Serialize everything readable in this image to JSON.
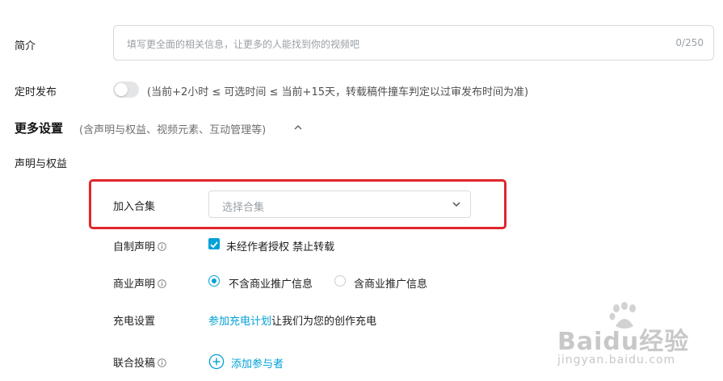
{
  "description": {
    "label": "简介",
    "placeholder": "填写更全面的相关信息，让更多的人能找到你的视频吧",
    "counter": "0/250"
  },
  "schedule": {
    "label": "定时发布",
    "hint": "(当前+2小时 ≤ 可选时间 ≤ 当前+15天，转载稿件撞车判定以过审发布时间为准)",
    "enabled": false
  },
  "more_settings": {
    "title": "更多设置",
    "subtitle": "(含声明与权益、视频元素、互动管理等)"
  },
  "rights": {
    "section_label": "声明与权益",
    "collection": {
      "label": "加入合集",
      "placeholder": "选择合集"
    },
    "self_made": {
      "label": "自制声明",
      "checkbox_text": "未经作者授权 禁止转载",
      "checked": true
    },
    "commercial": {
      "label": "商业声明",
      "options": [
        "不含商业推广信息",
        "含商业推广信息"
      ],
      "selected": "不含商业推广信息"
    },
    "charging": {
      "label": "充电设置",
      "link_text": "参加充电计划",
      "text": "让我们为您的创作充电"
    },
    "joint": {
      "label": "联合投稿",
      "add_text": "添加参与者"
    }
  },
  "colors": {
    "accent": "#00a1d6",
    "highlight_border": "#e0262d"
  },
  "watermark": {
    "brand": "Baidu经验",
    "url": "jingyan.baidu.com"
  }
}
